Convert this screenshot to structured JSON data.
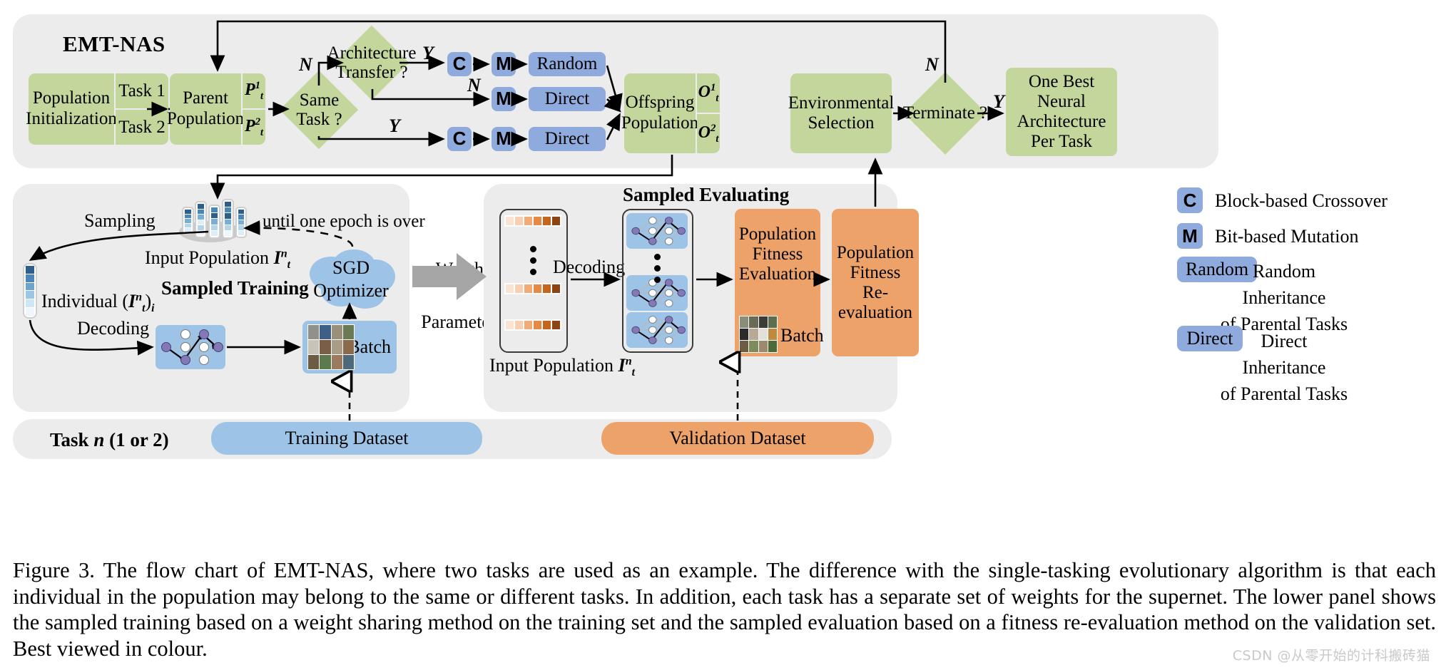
{
  "figure": {
    "title": "EMT-NAS",
    "caption": "Figure 3.  The flow chart of EMT-NAS, where two tasks are used as an example.  The difference with the single-tasking evolutionary algorithm is that each individual in the population may belong to the same or different tasks. In addition, each task has a separate set of weights for the supernet. The lower panel shows the sampled training based on a weight sharing method on the training set and the sampled evaluation based on a fitness re-evaluation method on the validation set. Best viewed in colour.",
    "watermark": "CSDN @从零开始的计科搬砖猫"
  },
  "top_flow": {
    "population_init": {
      "label": "Population Initialization",
      "task1": "Task 1",
      "task2": "Task 2"
    },
    "parent_population": {
      "label": "Parent Population",
      "p1": "P",
      "p1_sup": "1",
      "p1_sub": "t",
      "p2": "P",
      "p2_sup": "2",
      "p2_sub": "t"
    },
    "same_task_decision": {
      "line1": "Same",
      "line2": "Task ?"
    },
    "arch_transfer_decision": {
      "line1": "Architecture",
      "line2": "Transfer ?"
    },
    "offspring_population": {
      "label": "Offspring Population",
      "o1": "O",
      "o1_sup": "1",
      "o1_sub": "t",
      "o2": "O",
      "o2_sup": "2",
      "o2_sub": "t"
    },
    "environmental_selection": {
      "line1": "Environmental",
      "line2": "Selection"
    },
    "terminate_decision": {
      "label": "Terminate ?"
    },
    "result": {
      "line1": "One Best",
      "line2": "Neural",
      "line3": "Architecture",
      "line4": "Per Task"
    },
    "branches": [
      {
        "edge_label": "Y",
        "ops": [
          "C",
          "M"
        ],
        "inherit": "Random"
      },
      {
        "edge_label": "N",
        "ops": [
          "M"
        ],
        "inherit": "Direct"
      },
      {
        "edge_label": "Y",
        "ops": [
          "C",
          "M"
        ],
        "inherit": "Direct"
      }
    ],
    "edge_labels": {
      "same_task_no": "N",
      "arch_transfer_no": "N",
      "terminate_no": "N",
      "terminate_yes": "Y"
    }
  },
  "training_panel": {
    "title": "Sampled Training",
    "sampling_label": "Sampling",
    "loop_label": "until one epoch is over",
    "input_population": {
      "text": "Input Population ",
      "sym": "I",
      "sup": "n",
      "sub": "t"
    },
    "individual": {
      "text": "Individual ",
      "open": "(",
      "sym": "I",
      "sup": "n",
      "sub": "t",
      "close": ")",
      "idx": "i"
    },
    "decoding_label": "Decoding",
    "sgd": {
      "line1": "SGD",
      "line2": "Optimizer"
    },
    "batch_label": "Batch"
  },
  "transfer": {
    "line1": "Weight",
    "line2": "Parameters"
  },
  "evaluating_panel": {
    "title": "Sampled Evaluating",
    "input_population": {
      "text": "Input Population ",
      "sym": "I",
      "sup": "n",
      "sub": "t"
    },
    "decoding_label": "Decoding",
    "fitness_eval": {
      "line1": "Population",
      "line2": "Fitness",
      "line3": "Evaluation"
    },
    "fitness_reeval": {
      "line1": "Population",
      "line2": "Fitness",
      "line3": "Re-",
      "line4": "evaluation"
    },
    "batch_label": "Batch"
  },
  "bottom_bars": {
    "task_label_bold": "Task ",
    "task_label_italic": "n",
    "task_label_tail": " (1 or 2)",
    "training_dataset": "Training Dataset",
    "validation_dataset": "Validation Dataset"
  },
  "legend": [
    {
      "badge": "C",
      "type": "square",
      "desc": "Block-based Crossover"
    },
    {
      "badge": "M",
      "type": "square",
      "desc": "Bit-based Mutation"
    },
    {
      "badge": "Random",
      "type": "pill",
      "desc": "Random\nInheritance\nof Parental Tasks"
    },
    {
      "badge": "Direct",
      "type": "pill",
      "desc": "Direct\nInheritance\nof Parental Tasks"
    }
  ],
  "colors": {
    "green": "#c3d69b",
    "blue": "#8faadc",
    "light_blue": "#9dc3e6",
    "orange": "#eda26a",
    "panel_grey": "#ececec",
    "arrow": "#000000",
    "watermark": "#c9c9c9"
  }
}
